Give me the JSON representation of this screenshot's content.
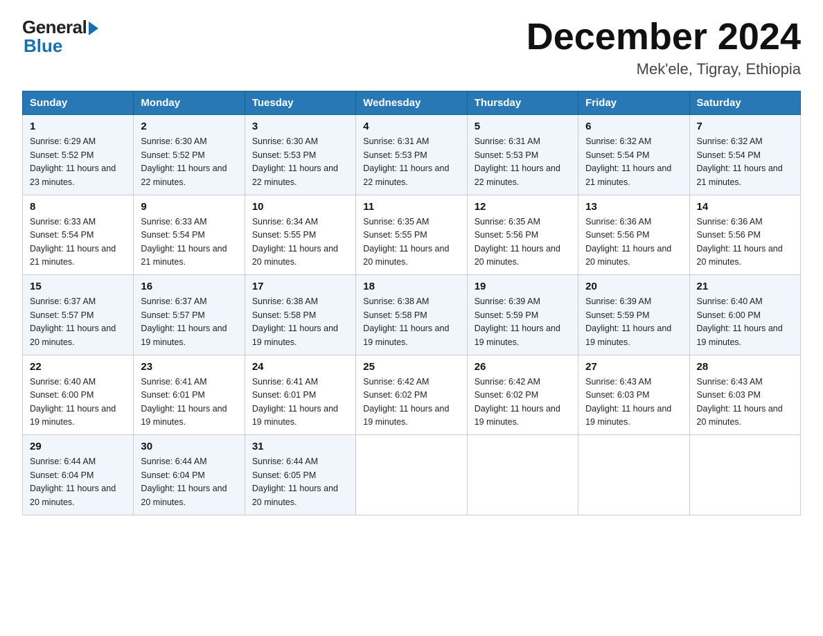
{
  "logo": {
    "general_text": "General",
    "blue_text": "Blue"
  },
  "title": {
    "month_year": "December 2024",
    "location": "Mek'ele, Tigray, Ethiopia"
  },
  "headers": [
    "Sunday",
    "Monday",
    "Tuesday",
    "Wednesday",
    "Thursday",
    "Friday",
    "Saturday"
  ],
  "weeks": [
    [
      {
        "day": "1",
        "sunrise": "6:29 AM",
        "sunset": "5:52 PM",
        "daylight": "11 hours and 23 minutes."
      },
      {
        "day": "2",
        "sunrise": "6:30 AM",
        "sunset": "5:52 PM",
        "daylight": "11 hours and 22 minutes."
      },
      {
        "day": "3",
        "sunrise": "6:30 AM",
        "sunset": "5:53 PM",
        "daylight": "11 hours and 22 minutes."
      },
      {
        "day": "4",
        "sunrise": "6:31 AM",
        "sunset": "5:53 PM",
        "daylight": "11 hours and 22 minutes."
      },
      {
        "day": "5",
        "sunrise": "6:31 AM",
        "sunset": "5:53 PM",
        "daylight": "11 hours and 22 minutes."
      },
      {
        "day": "6",
        "sunrise": "6:32 AM",
        "sunset": "5:54 PM",
        "daylight": "11 hours and 21 minutes."
      },
      {
        "day": "7",
        "sunrise": "6:32 AM",
        "sunset": "5:54 PM",
        "daylight": "11 hours and 21 minutes."
      }
    ],
    [
      {
        "day": "8",
        "sunrise": "6:33 AM",
        "sunset": "5:54 PM",
        "daylight": "11 hours and 21 minutes."
      },
      {
        "day": "9",
        "sunrise": "6:33 AM",
        "sunset": "5:54 PM",
        "daylight": "11 hours and 21 minutes."
      },
      {
        "day": "10",
        "sunrise": "6:34 AM",
        "sunset": "5:55 PM",
        "daylight": "11 hours and 20 minutes."
      },
      {
        "day": "11",
        "sunrise": "6:35 AM",
        "sunset": "5:55 PM",
        "daylight": "11 hours and 20 minutes."
      },
      {
        "day": "12",
        "sunrise": "6:35 AM",
        "sunset": "5:56 PM",
        "daylight": "11 hours and 20 minutes."
      },
      {
        "day": "13",
        "sunrise": "6:36 AM",
        "sunset": "5:56 PM",
        "daylight": "11 hours and 20 minutes."
      },
      {
        "day": "14",
        "sunrise": "6:36 AM",
        "sunset": "5:56 PM",
        "daylight": "11 hours and 20 minutes."
      }
    ],
    [
      {
        "day": "15",
        "sunrise": "6:37 AM",
        "sunset": "5:57 PM",
        "daylight": "11 hours and 20 minutes."
      },
      {
        "day": "16",
        "sunrise": "6:37 AM",
        "sunset": "5:57 PM",
        "daylight": "11 hours and 19 minutes."
      },
      {
        "day": "17",
        "sunrise": "6:38 AM",
        "sunset": "5:58 PM",
        "daylight": "11 hours and 19 minutes."
      },
      {
        "day": "18",
        "sunrise": "6:38 AM",
        "sunset": "5:58 PM",
        "daylight": "11 hours and 19 minutes."
      },
      {
        "day": "19",
        "sunrise": "6:39 AM",
        "sunset": "5:59 PM",
        "daylight": "11 hours and 19 minutes."
      },
      {
        "day": "20",
        "sunrise": "6:39 AM",
        "sunset": "5:59 PM",
        "daylight": "11 hours and 19 minutes."
      },
      {
        "day": "21",
        "sunrise": "6:40 AM",
        "sunset": "6:00 PM",
        "daylight": "11 hours and 19 minutes."
      }
    ],
    [
      {
        "day": "22",
        "sunrise": "6:40 AM",
        "sunset": "6:00 PM",
        "daylight": "11 hours and 19 minutes."
      },
      {
        "day": "23",
        "sunrise": "6:41 AM",
        "sunset": "6:01 PM",
        "daylight": "11 hours and 19 minutes."
      },
      {
        "day": "24",
        "sunrise": "6:41 AM",
        "sunset": "6:01 PM",
        "daylight": "11 hours and 19 minutes."
      },
      {
        "day": "25",
        "sunrise": "6:42 AM",
        "sunset": "6:02 PM",
        "daylight": "11 hours and 19 minutes."
      },
      {
        "day": "26",
        "sunrise": "6:42 AM",
        "sunset": "6:02 PM",
        "daylight": "11 hours and 19 minutes."
      },
      {
        "day": "27",
        "sunrise": "6:43 AM",
        "sunset": "6:03 PM",
        "daylight": "11 hours and 19 minutes."
      },
      {
        "day": "28",
        "sunrise": "6:43 AM",
        "sunset": "6:03 PM",
        "daylight": "11 hours and 20 minutes."
      }
    ],
    [
      {
        "day": "29",
        "sunrise": "6:44 AM",
        "sunset": "6:04 PM",
        "daylight": "11 hours and 20 minutes."
      },
      {
        "day": "30",
        "sunrise": "6:44 AM",
        "sunset": "6:04 PM",
        "daylight": "11 hours and 20 minutes."
      },
      {
        "day": "31",
        "sunrise": "6:44 AM",
        "sunset": "6:05 PM",
        "daylight": "11 hours and 20 minutes."
      },
      null,
      null,
      null,
      null
    ]
  ]
}
